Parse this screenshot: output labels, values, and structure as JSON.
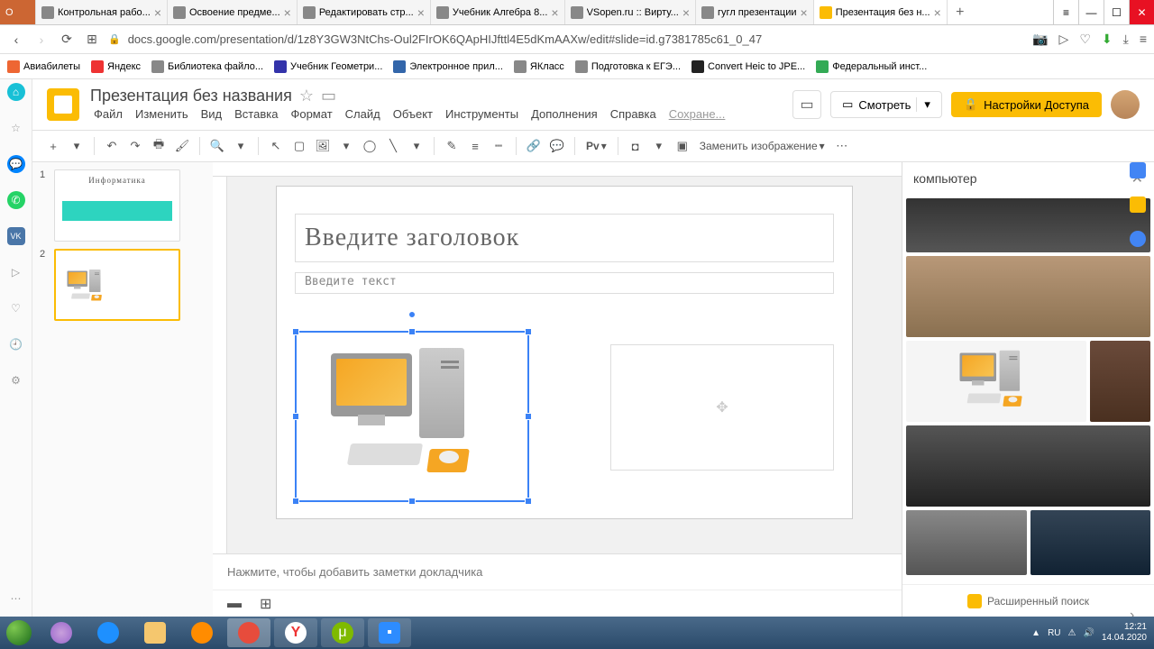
{
  "browser": {
    "tabs": [
      {
        "title": "Контрольная рабо..."
      },
      {
        "title": "Освоение предме..."
      },
      {
        "title": "Редактировать стр..."
      },
      {
        "title": "Учебник Алгебра 8..."
      },
      {
        "title": "VSopen.ru :: Вирту..."
      },
      {
        "title": "гугл презентации"
      },
      {
        "title": "Презентация без н..."
      }
    ],
    "url": "docs.google.com/presentation/d/1z8Y3GW3NtChs-Oul2FIrOK6QApHIJfttl4E5dKmAAXw/edit#slide=id.g7381785c61_0_47",
    "bookmarks": [
      "Авиабилеты",
      "Яндекс",
      "Библиотека файло...",
      "Учебник Геометри...",
      "Электронное прил...",
      "ЯКласс",
      "Подготовка к ЕГЭ...",
      "Convert Heic to JPE...",
      "Федеральный инст..."
    ]
  },
  "app": {
    "doc_title": "Презентация без названия",
    "menu": [
      "Файл",
      "Изменить",
      "Вид",
      "Вставка",
      "Формат",
      "Слайд",
      "Объект",
      "Инструменты",
      "Дополнения",
      "Справка"
    ],
    "saving": "Сохране...",
    "present": "Смотреть",
    "share": "Настройки Доступа"
  },
  "toolbar": {
    "replace_image": "Заменить изображение"
  },
  "slides": {
    "thumb1_title": "Информатика",
    "title_placeholder": "Введите заголовок",
    "text_placeholder": "Введите текст",
    "notes_placeholder": "Нажмите, чтобы добавить заметки докладчика"
  },
  "explore": {
    "query": "компьютер",
    "adv_search": "Расширенный поиск"
  },
  "taskbar": {
    "lang": "RU",
    "time": "12:21",
    "date": "14.04.2020"
  }
}
